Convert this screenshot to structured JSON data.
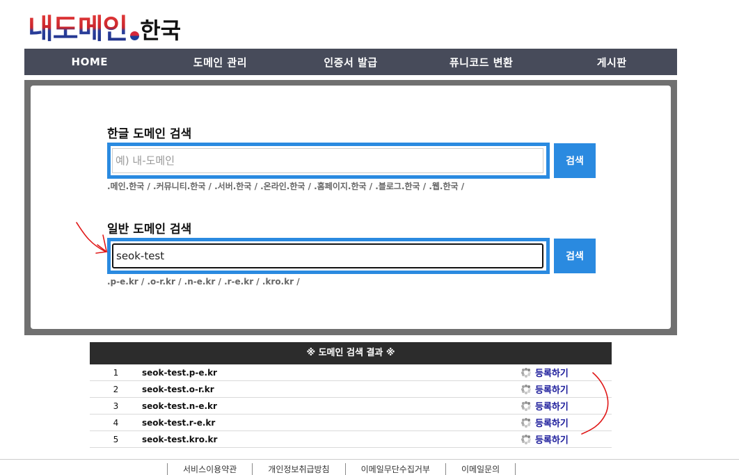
{
  "logo": {
    "main": "내도메인",
    "sub": "한국"
  },
  "nav": {
    "items": [
      {
        "label": "HOME"
      },
      {
        "label": "도메인 관리"
      },
      {
        "label": "인증서 발급"
      },
      {
        "label": "퓨니코드 변환"
      },
      {
        "label": "게시판"
      }
    ]
  },
  "korean_search": {
    "title": "한글 도메인 검색",
    "placeholder": "예) 내-도메인",
    "value": "",
    "button": "검색",
    "tlds": ".메인.한국 / .커뮤니티.한국 / .서버.한국 / .온라인.한국 / .홈페이지.한국 / .블로그.한국 / .웹.한국 /"
  },
  "general_search": {
    "title": "일반 도메인 검색",
    "value": "seok-test",
    "button": "검색",
    "tlds": ".p-e.kr / .o-r.kr / .n-e.kr / .r-e.kr / .kro.kr /"
  },
  "results": {
    "header": "※ 도메인 검색 결과 ※",
    "rows": [
      {
        "num": "1",
        "domain": "seok-test.p-e.kr",
        "action": "등록하기"
      },
      {
        "num": "2",
        "domain": "seok-test.o-r.kr",
        "action": "등록하기"
      },
      {
        "num": "3",
        "domain": "seok-test.n-e.kr",
        "action": "등록하기"
      },
      {
        "num": "4",
        "domain": "seok-test.r-e.kr",
        "action": "등록하기"
      },
      {
        "num": "5",
        "domain": "seok-test.kro.kr",
        "action": "등록하기"
      }
    ]
  },
  "footer": {
    "links": [
      "서비스이용약관",
      "개인정보취급방침",
      "이메일무단수집거부",
      "이메일문의"
    ]
  },
  "colors": {
    "accent": "#2a8ae0",
    "nav": "#474b5a",
    "annotation": "#e01818"
  }
}
